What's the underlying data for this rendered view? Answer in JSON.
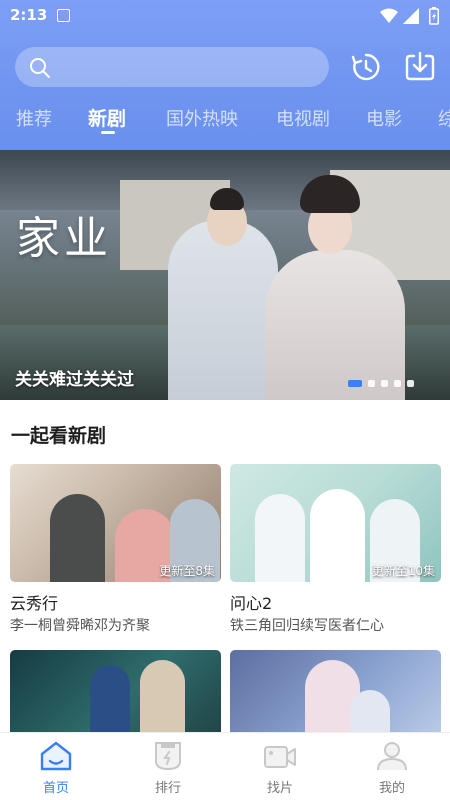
{
  "status_bar": {
    "time": "2:13"
  },
  "search": {
    "placeholder": ""
  },
  "tabs": [
    "推荐",
    "新剧",
    "国外热映",
    "电视剧",
    "电影",
    "综"
  ],
  "active_tab": "新剧",
  "banner": {
    "title": "家业",
    "caption": "关关难过关关过",
    "page_count": 5,
    "active_page": 1
  },
  "section": {
    "title": "一起看新剧"
  },
  "cards": [
    {
      "name": "云秀行",
      "desc": "李一桐曾舜晞邓为齐聚",
      "badge": "更新至8集"
    },
    {
      "name": "问心2",
      "desc": "铁三角回归续写医者仁心",
      "badge": "更新至10集"
    },
    {
      "name": "",
      "desc": "",
      "badge": ""
    },
    {
      "name": "",
      "desc": "",
      "badge": ""
    }
  ],
  "bottom_nav": [
    {
      "label": "首页",
      "icon": "home-icon"
    },
    {
      "label": "排行",
      "icon": "ranking-icon"
    },
    {
      "label": "找片",
      "icon": "video-camera-icon"
    },
    {
      "label": "我的",
      "icon": "person-icon"
    }
  ],
  "colors": {
    "accent": "#3b7ef4",
    "header": "#7499f1"
  }
}
